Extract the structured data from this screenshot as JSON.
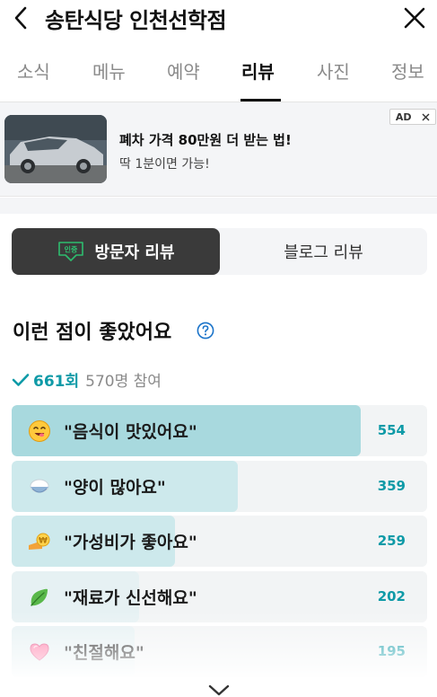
{
  "header": {
    "title": "송탄식당 인천선학점"
  },
  "tabs": [
    {
      "label": "소식",
      "active": false
    },
    {
      "label": "메뉴",
      "active": false
    },
    {
      "label": "예약",
      "active": false
    },
    {
      "label": "리뷰",
      "active": true
    },
    {
      "label": "사진",
      "active": false
    },
    {
      "label": "정보",
      "active": false
    }
  ],
  "ad": {
    "title": "폐차 가격 80만원 더 받는 법!",
    "subtitle": "딱 1분이면 가능!",
    "badge": "AD"
  },
  "review_toggle": {
    "visitor_badge": "인증",
    "visitor_label": "방문자 리뷰",
    "blog_label": "블로그 리뷰",
    "selected": "visitor"
  },
  "section": {
    "title": "이런 점이 좋았어요",
    "summary_count": "661회",
    "summary_people": "570명 참여"
  },
  "keywords": [
    {
      "label": "\"음식이 맛있어요\"",
      "count": "554",
      "value": 554,
      "icon": "yum-face-icon"
    },
    {
      "label": "\"양이 많아요\"",
      "count": "359",
      "value": 359,
      "icon": "rice-bowl-icon"
    },
    {
      "label": "\"가성비가 좋아요\"",
      "count": "259",
      "value": 259,
      "icon": "coin-hand-icon"
    },
    {
      "label": "\"재료가 신선해요\"",
      "count": "202",
      "value": 202,
      "icon": "leaf-icon"
    },
    {
      "label": "\"친절해요\"",
      "count": "195",
      "value": 195,
      "icon": "heart-icon"
    }
  ],
  "colors": {
    "accent": "#0e9aa7",
    "bar_top": "#a8d9de",
    "bar": "#cde9ec",
    "bar_muted": "#e6f1f3"
  }
}
